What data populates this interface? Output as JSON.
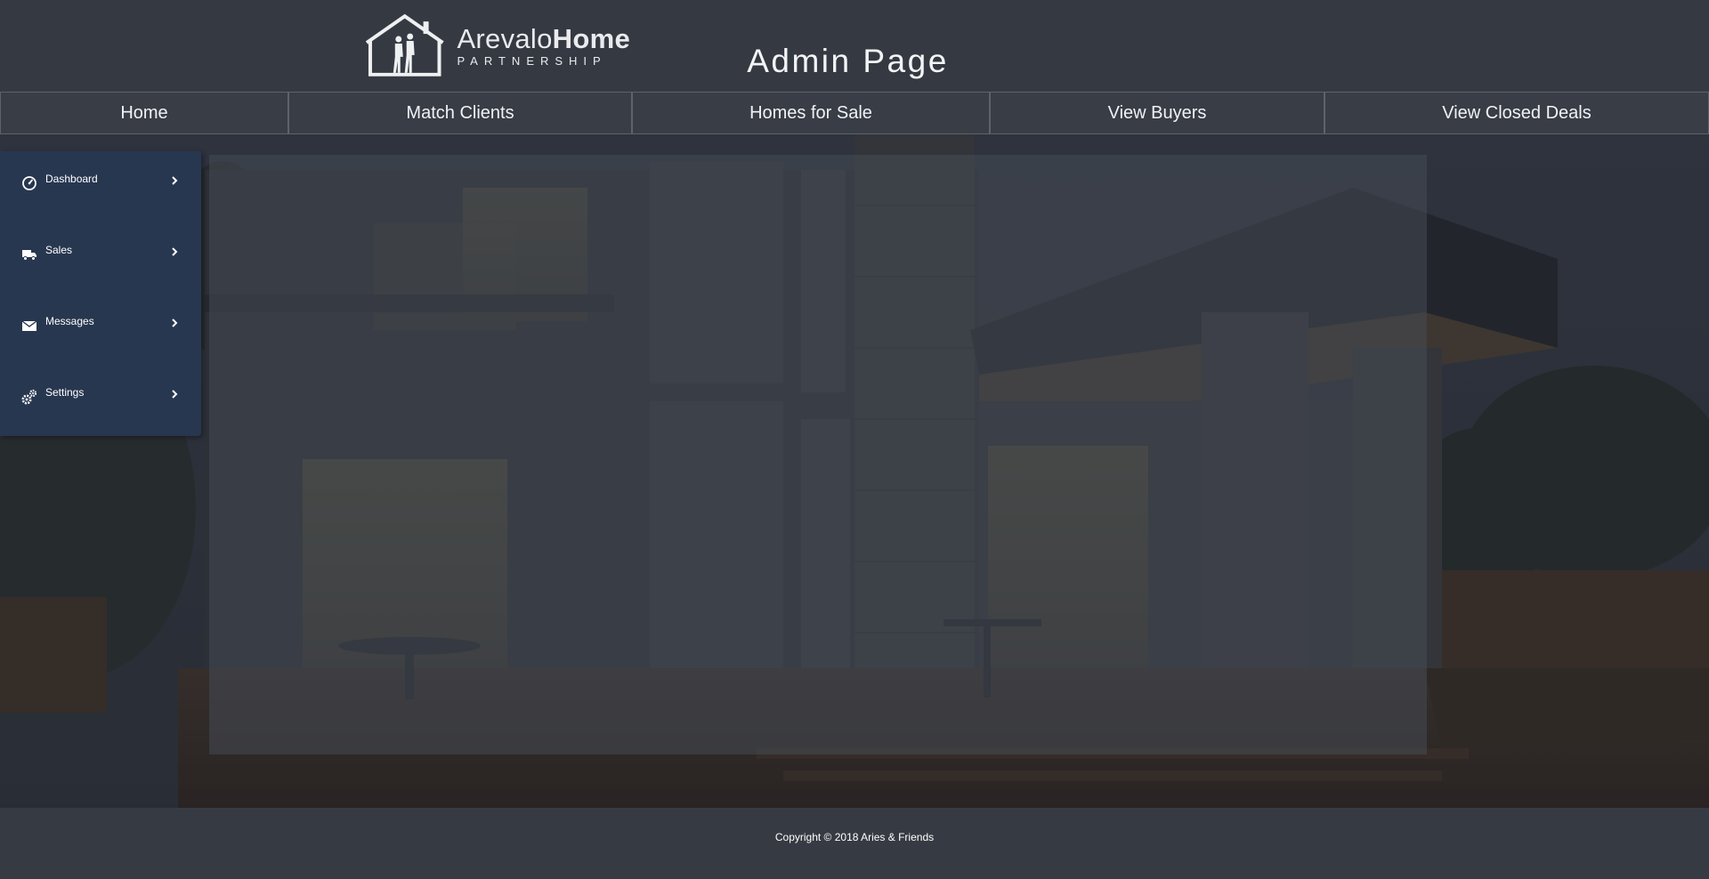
{
  "header": {
    "logo_text_light": "Arevalo",
    "logo_text_bold": "Home",
    "logo_subtext": "PARTNERSHIP",
    "page_title": "Admin Page"
  },
  "topnav": {
    "items": [
      {
        "label": "Home"
      },
      {
        "label": "Match Clients"
      },
      {
        "label": "Homes for Sale"
      },
      {
        "label": "View Buyers"
      },
      {
        "label": "View Closed Deals"
      }
    ]
  },
  "sidebar": {
    "items": [
      {
        "label": "Dashboard",
        "icon": "dashboard-gauge-icon"
      },
      {
        "label": "Sales",
        "icon": "truck-icon"
      },
      {
        "label": "Messages",
        "icon": "envelope-icon"
      },
      {
        "label": "Settings",
        "icon": "gears-icon"
      }
    ]
  },
  "footer": {
    "copyright": "Copyright © 2018 Aries & Friends"
  },
  "colors": {
    "header_bg": "#353a42",
    "sidebar_bg": "#283750",
    "footer_bg": "#363b43",
    "nav_border": "#5d636b"
  }
}
